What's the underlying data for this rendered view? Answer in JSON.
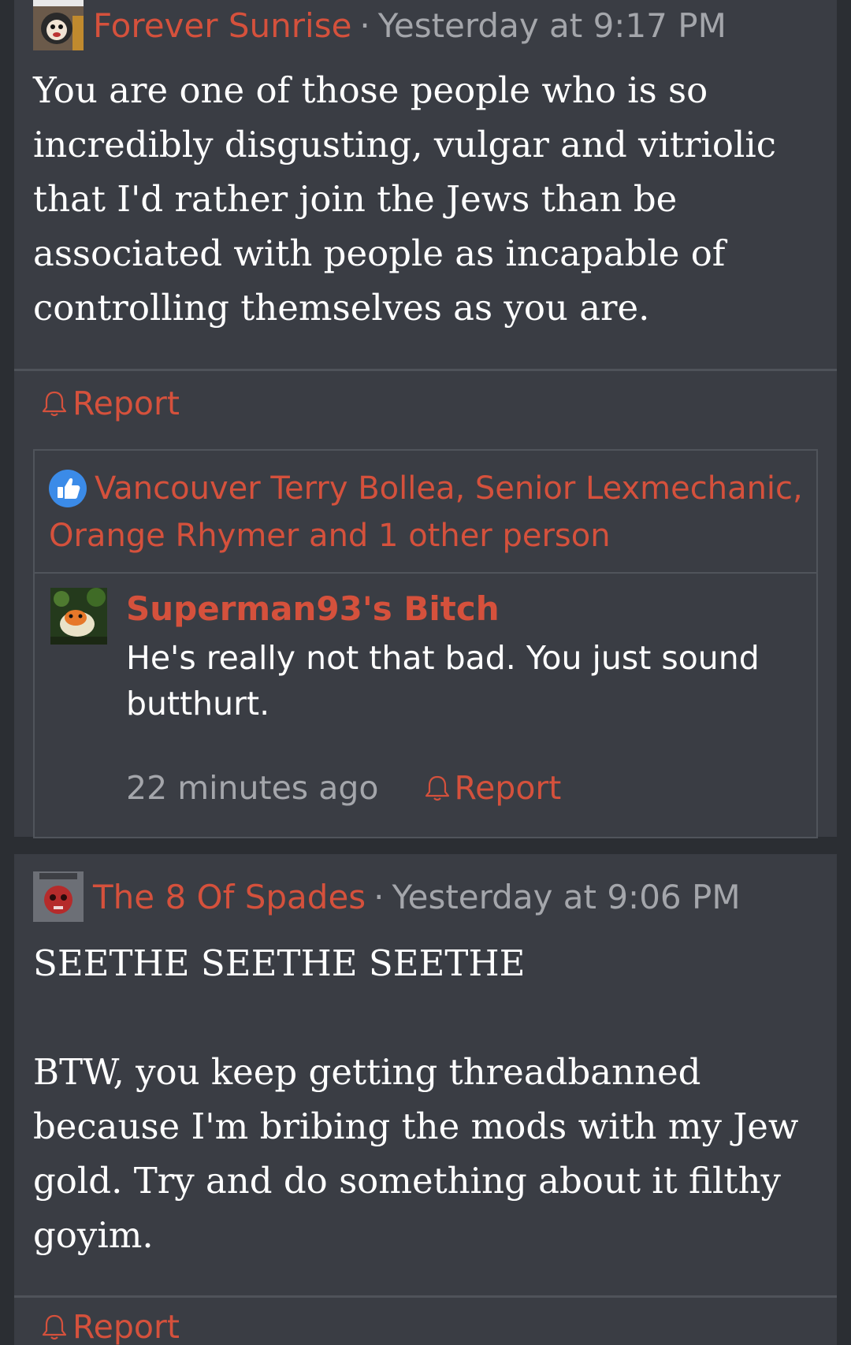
{
  "posts": [
    {
      "author": "Forever Sunrise",
      "separator": "·",
      "timestamp": "Yesterday at 9:17 PM",
      "body": "You are one of those people who is so incredibly disgusting, vulgar and vitriolic that I'd rather join the Jews than be associated with people as incapable of controlling themselves as you are.",
      "report_label": "Report",
      "likes": "Vancouver Terry Bollea, Senior Lexmechanic, Orange Rhymer and 1 other person",
      "comment": {
        "author": "Superman93's Bitch",
        "text": "He's really not that bad. You just sound butthurt.",
        "time": "22 minutes ago",
        "report_label": "Report"
      }
    },
    {
      "author": "The 8 Of Spades",
      "separator": "·",
      "timestamp": "Yesterday at 9:06 PM",
      "body_paragraphs": [
        "SEETHE SEETHE SEETHE",
        "BTW, you keep getting threadbanned because I'm bribing the mods with my Jew gold. Try and do something about it filthy goyim."
      ],
      "report_label": "Report"
    }
  ],
  "colors": {
    "background": "#2b2e33",
    "card": "#3a3d44",
    "accent": "#d5513c",
    "muted": "#a4a6ab",
    "text": "#ffffff"
  },
  "icons": {
    "report": "bell-icon",
    "like": "thumbs-up-icon"
  }
}
